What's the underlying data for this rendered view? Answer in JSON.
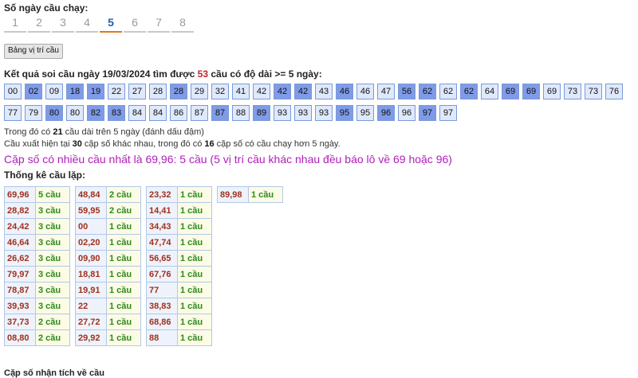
{
  "days_label": "Số ngày cầu chạy:",
  "days": [
    "1",
    "2",
    "3",
    "4",
    "5",
    "6",
    "7",
    "8"
  ],
  "active_day": "5",
  "position_button": "Bảng vị trí cầu",
  "result": {
    "prefix": "Kết quả soi cầu ngày 19/03/2024 tìm được ",
    "count": "53",
    "suffix": " cầu có độ dài >= 5 ngày:"
  },
  "numbers": [
    {
      "n": "00",
      "b": false
    },
    {
      "n": "02",
      "b": true
    },
    {
      "n": "09",
      "b": false
    },
    {
      "n": "18",
      "b": true
    },
    {
      "n": "19",
      "b": true
    },
    {
      "n": "22",
      "b": false
    },
    {
      "n": "27",
      "b": false
    },
    {
      "n": "28",
      "b": false
    },
    {
      "n": "28",
      "b": true
    },
    {
      "n": "29",
      "b": false
    },
    {
      "n": "32",
      "b": false
    },
    {
      "n": "41",
      "b": false
    },
    {
      "n": "42",
      "b": false
    },
    {
      "n": "42",
      "b": true
    },
    {
      "n": "42",
      "b": true
    },
    {
      "n": "43",
      "b": false
    },
    {
      "n": "46",
      "b": true
    },
    {
      "n": "46",
      "b": false
    },
    {
      "n": "47",
      "b": false
    },
    {
      "n": "56",
      "b": true
    },
    {
      "n": "62",
      "b": true
    },
    {
      "n": "62",
      "b": false
    },
    {
      "n": "62",
      "b": true
    },
    {
      "n": "64",
      "b": false
    },
    {
      "n": "69",
      "b": true
    },
    {
      "n": "69",
      "b": true
    },
    {
      "n": "69",
      "b": false
    },
    {
      "n": "73",
      "b": false
    },
    {
      "n": "73",
      "b": false
    },
    {
      "n": "76",
      "b": false
    },
    {
      "n": "77",
      "b": false
    },
    {
      "n": "79",
      "b": false
    },
    {
      "n": "80",
      "b": true
    },
    {
      "n": "80",
      "b": false
    },
    {
      "n": "82",
      "b": true
    },
    {
      "n": "83",
      "b": true
    },
    {
      "n": "84",
      "b": false
    },
    {
      "n": "84",
      "b": false
    },
    {
      "n": "86",
      "b": false
    },
    {
      "n": "87",
      "b": false
    },
    {
      "n": "87",
      "b": true
    },
    {
      "n": "88",
      "b": false
    },
    {
      "n": "89",
      "b": true
    },
    {
      "n": "93",
      "b": false
    },
    {
      "n": "93",
      "b": false
    },
    {
      "n": "93",
      "b": false
    },
    {
      "n": "95",
      "b": true
    },
    {
      "n": "95",
      "b": false
    },
    {
      "n": "96",
      "b": true
    },
    {
      "n": "96",
      "b": false
    },
    {
      "n": "97",
      "b": true
    },
    {
      "n": "97",
      "b": false
    }
  ],
  "info1": {
    "a": "Trong đó có ",
    "b": "21",
    "c": " cầu dài trên 5 ngày (đánh dấu đậm)"
  },
  "info2": {
    "a": "Cầu xuất hiện tại ",
    "b": "30",
    "c": " cặp số khác nhau, trong đó có ",
    "d": "16",
    "e": " cặp số có cầu chạy hơn 5 ngày."
  },
  "highlight": "Cặp số có nhiều cầu nhất là 69,96: 5 cầu (5 vị trí cầu khác nhau đều báo lô về 69 hoặc 96)",
  "stat_title": "Thống kê cầu lặp:",
  "stats": [
    [
      [
        "69,96",
        "5 cầu"
      ],
      [
        "28,82",
        "3 cầu"
      ],
      [
        "24,42",
        "3 cầu"
      ],
      [
        "46,64",
        "3 cầu"
      ],
      [
        "26,62",
        "3 cầu"
      ],
      [
        "79,97",
        "3 cầu"
      ],
      [
        "78,87",
        "3 cầu"
      ],
      [
        "39,93",
        "3 cầu"
      ],
      [
        "37,73",
        "2 cầu"
      ],
      [
        "08,80",
        "2 cầu"
      ]
    ],
    [
      [
        "48,84",
        "2 cầu"
      ],
      [
        "59,95",
        "2 cầu"
      ],
      [
        "00",
        "1 cầu"
      ],
      [
        "02,20",
        "1 cầu"
      ],
      [
        "09,90",
        "1 cầu"
      ],
      [
        "18,81",
        "1 cầu"
      ],
      [
        "19,91",
        "1 cầu"
      ],
      [
        "22",
        "1 cầu"
      ],
      [
        "27,72",
        "1 cầu"
      ],
      [
        "29,92",
        "1 cầu"
      ]
    ],
    [
      [
        "23,32",
        "1 cầu"
      ],
      [
        "14,41",
        "1 cầu"
      ],
      [
        "34,43",
        "1 cầu"
      ],
      [
        "47,74",
        "1 cầu"
      ],
      [
        "56,65",
        "1 cầu"
      ],
      [
        "67,76",
        "1 cầu"
      ],
      [
        "77",
        "1 cầu"
      ],
      [
        "38,83",
        "1 cầu"
      ],
      [
        "68,86",
        "1 cầu"
      ],
      [
        "88",
        "1 cầu"
      ]
    ],
    [
      [
        "89,98",
        "1 cầu"
      ]
    ]
  ],
  "bottom_text": "Cặp số nhận tích về cầu"
}
